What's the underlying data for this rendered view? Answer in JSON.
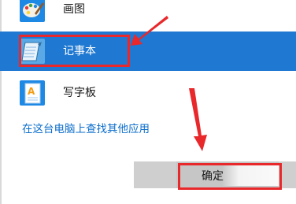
{
  "apps": [
    {
      "label": "画图",
      "icon": "paint-icon",
      "selected": false
    },
    {
      "label": "记事本",
      "icon": "notepad-icon",
      "selected": true
    },
    {
      "label": "写字板",
      "icon": "wordpad-icon",
      "selected": false
    }
  ],
  "find_link": "在这台电脑上查找其他应用",
  "ok_button": {
    "label": "确定"
  },
  "colors": {
    "selection": "#1f78d1",
    "link": "#0b6dcb",
    "annotation": "#e8282b"
  }
}
